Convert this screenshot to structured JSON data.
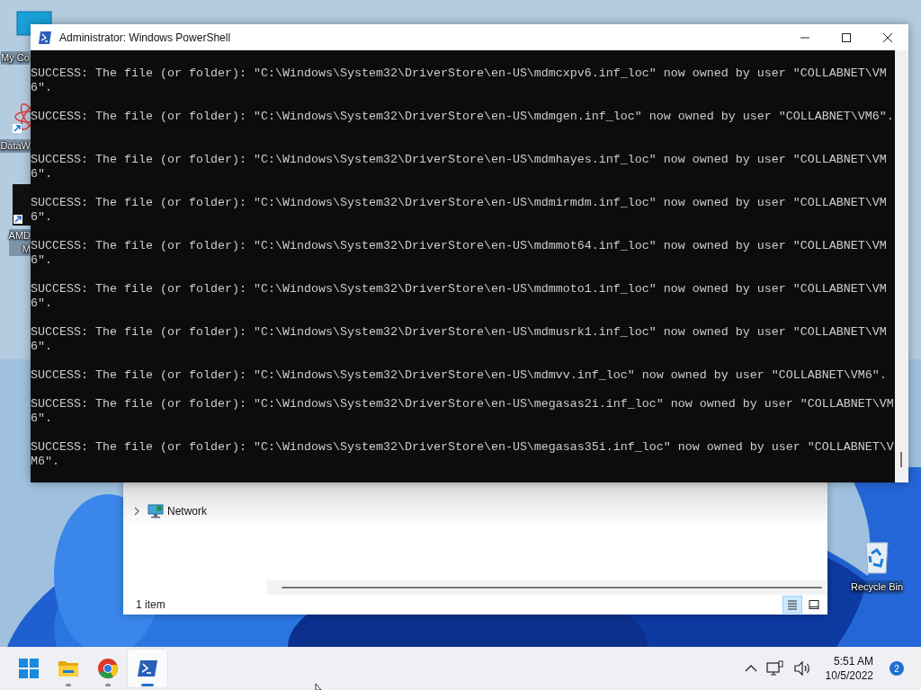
{
  "desktop": {
    "icons": [
      {
        "kind": "computer",
        "label_lines": [
          "My Co"
        ],
        "shortcut": false
      },
      {
        "kind": "molecule-app",
        "label_lines": [
          "DataW"
        ],
        "shortcut": true
      },
      {
        "kind": "amd-app",
        "label_lines": [
          "AMD",
          "M"
        ],
        "shortcut": true
      },
      {
        "kind": "recycle-bin",
        "label_lines": [
          "Recycle Bin"
        ],
        "shortcut": false
      }
    ]
  },
  "explorer": {
    "nav_items": [
      {
        "label": "Network",
        "expanded": false
      }
    ],
    "status": "1 item",
    "view_buttons": [
      {
        "kind": "details",
        "selected": true
      },
      {
        "kind": "tiles",
        "selected": false
      }
    ]
  },
  "powershell": {
    "title": "Administrator: Windows PowerShell",
    "output": [
      "SUCCESS: The file (or folder): \"C:\\Windows\\System32\\DriverStore\\en-US\\mdmcxpv6.inf_loc\" now owned by user \"COLLABNET\\VM6\".",
      "SUCCESS: The file (or folder): \"C:\\Windows\\System32\\DriverStore\\en-US\\mdmgen.inf_loc\" now owned by user \"COLLABNET\\VM6\".",
      "SUCCESS: The file (or folder): \"C:\\Windows\\System32\\DriverStore\\en-US\\mdmhayes.inf_loc\" now owned by user \"COLLABNET\\VM6\".",
      "SUCCESS: The file (or folder): \"C:\\Windows\\System32\\DriverStore\\en-US\\mdmirmdm.inf_loc\" now owned by user \"COLLABNET\\VM6\".",
      "SUCCESS: The file (or folder): \"C:\\Windows\\System32\\DriverStore\\en-US\\mdmmot64.inf_loc\" now owned by user \"COLLABNET\\VM6\".",
      "SUCCESS: The file (or folder): \"C:\\Windows\\System32\\DriverStore\\en-US\\mdmmoto1.inf_loc\" now owned by user \"COLLABNET\\VM6\".",
      "SUCCESS: The file (or folder): \"C:\\Windows\\System32\\DriverStore\\en-US\\mdmusrk1.inf_loc\" now owned by user \"COLLABNET\\VM6\".",
      "SUCCESS: The file (or folder): \"C:\\Windows\\System32\\DriverStore\\en-US\\mdmvv.inf_loc\" now owned by user \"COLLABNET\\VM6\".",
      "SUCCESS: The file (or folder): \"C:\\Windows\\System32\\DriverStore\\en-US\\megasas2i.inf_loc\" now owned by user \"COLLABNET\\VM6\".",
      "SUCCESS: The file (or folder): \"C:\\Windows\\System32\\DriverStore\\en-US\\megasas35i.inf_loc\" now owned by user \"COLLABNET\\VM6\"."
    ]
  },
  "taskbar": {
    "apps": [
      {
        "kind": "start",
        "running": false,
        "active": false
      },
      {
        "kind": "explorer",
        "running": true,
        "active": false
      },
      {
        "kind": "chrome",
        "running": true,
        "active": false
      },
      {
        "kind": "powershell",
        "running": true,
        "active": true
      }
    ],
    "tray": {
      "time": "5:51 AM",
      "date": "10/5/2022",
      "notifications": "2"
    }
  }
}
